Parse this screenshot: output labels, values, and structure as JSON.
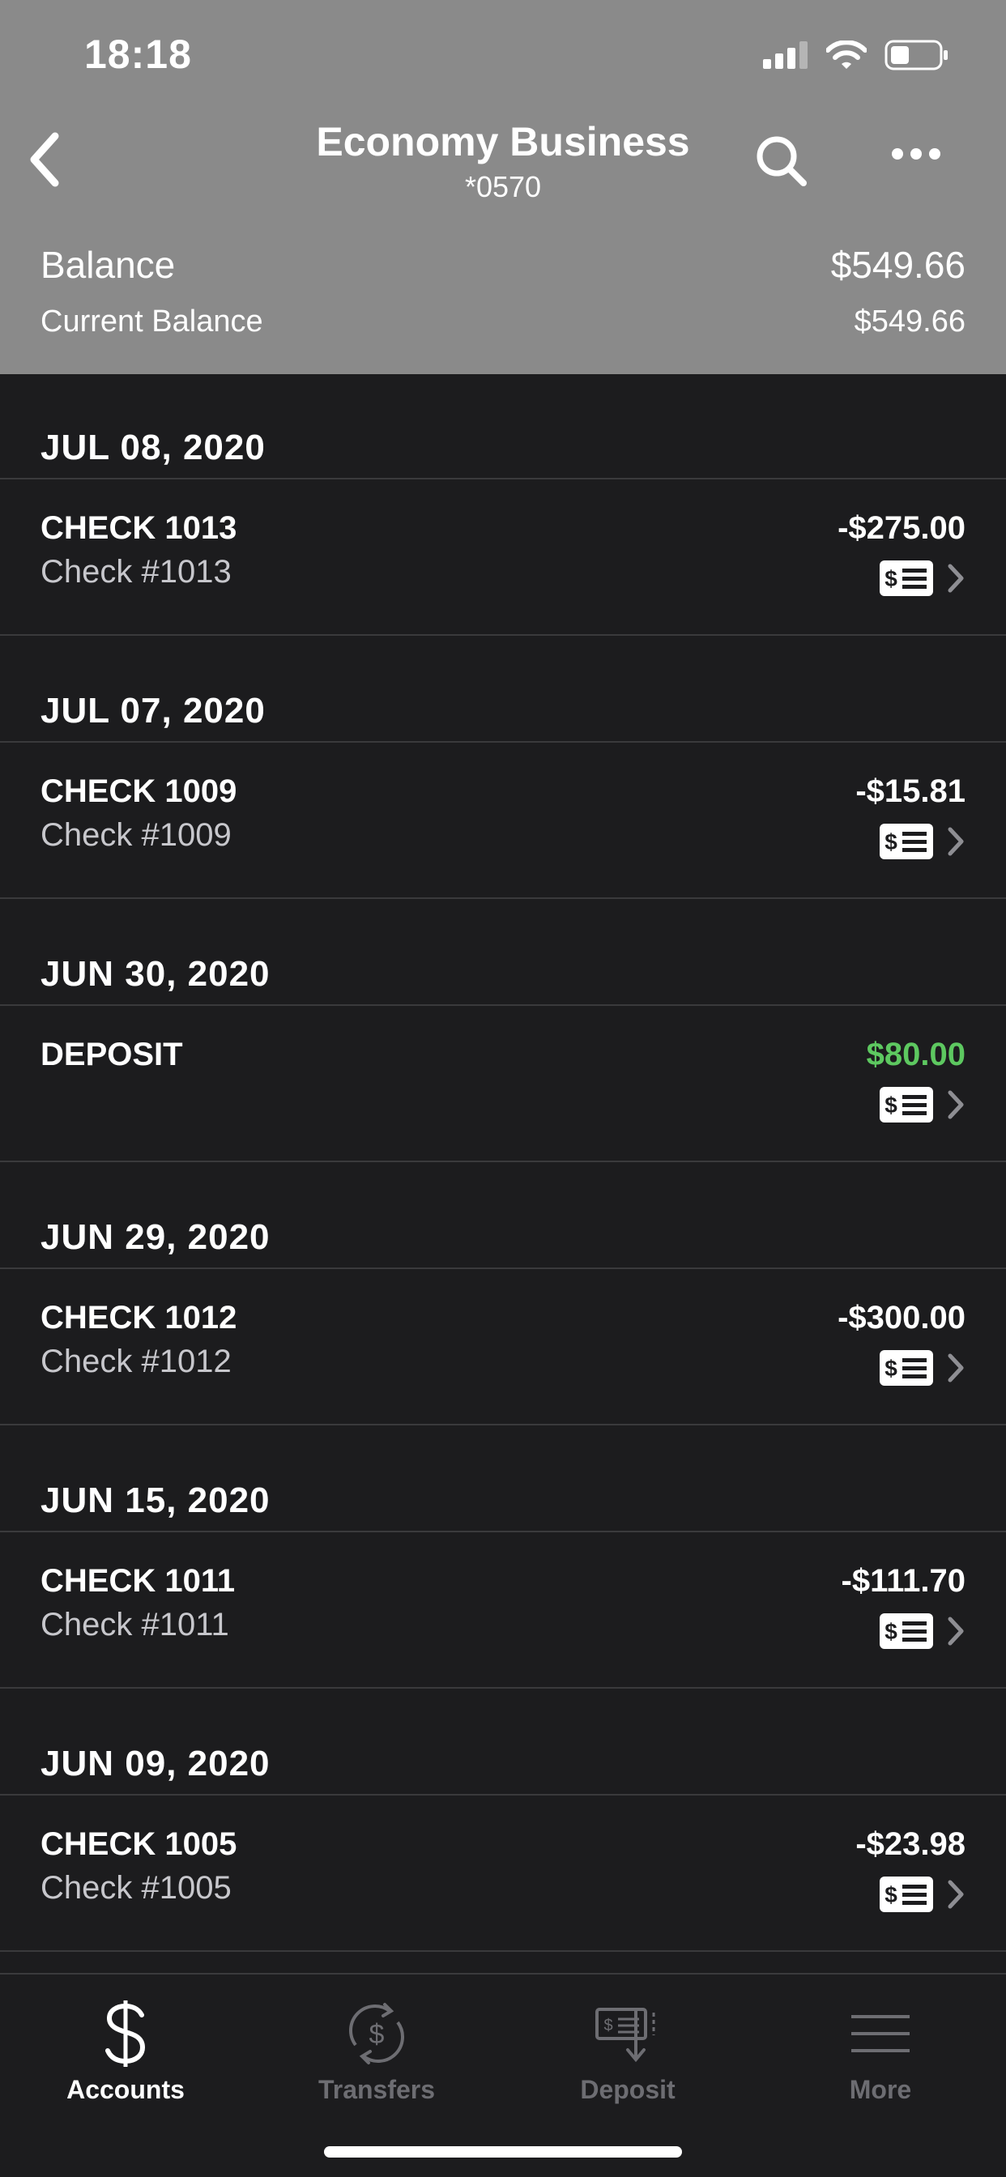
{
  "status_bar": {
    "time": "18:18"
  },
  "nav": {
    "title": "Economy Business",
    "subtitle": "*0570"
  },
  "balance": {
    "label": "Balance",
    "value": "$549.66",
    "current_label": "Current Balance",
    "current_value": "$549.66"
  },
  "groups": [
    {
      "date": "JUL 08, 2020",
      "title": "CHECK 1013",
      "sub": "Check #1013",
      "amount": "-$275.00"
    },
    {
      "date": "JUL 07, 2020",
      "title": "CHECK 1009",
      "sub": "Check #1009",
      "amount": "-$15.81"
    },
    {
      "date": "JUN 30, 2020",
      "title": "DEPOSIT",
      "sub": "",
      "amount": "$80.00"
    },
    {
      "date": "JUN 29, 2020",
      "title": "CHECK 1012",
      "sub": "Check #1012",
      "amount": "-$300.00"
    },
    {
      "date": "JUN 15, 2020",
      "title": "CHECK 1011",
      "sub": "Check #1011",
      "amount": "-$111.70"
    },
    {
      "date": "JUN 09, 2020",
      "title": "CHECK 1005",
      "sub": "Check #1005",
      "amount": "-$23.98"
    }
  ],
  "tabs": {
    "accounts": "Accounts",
    "transfers": "Transfers",
    "deposit": "Deposit",
    "more": "More"
  },
  "colors": {
    "header_bg": "#8a8a8a",
    "list_bg": "#1c1c1e",
    "positive_amount": "#5dc860",
    "inactive_tab": "#6d6d72"
  },
  "icons": {
    "back": "chevron-left-icon",
    "search": "search-icon",
    "more": "more-dots-icon",
    "check_image": "check-image-icon",
    "row_chevron": "chevron-right-icon",
    "accounts": "dollar-icon",
    "transfers": "transfer-cycle-icon",
    "deposit": "check-deposit-icon",
    "more_tab": "menu-lines-icon"
  }
}
